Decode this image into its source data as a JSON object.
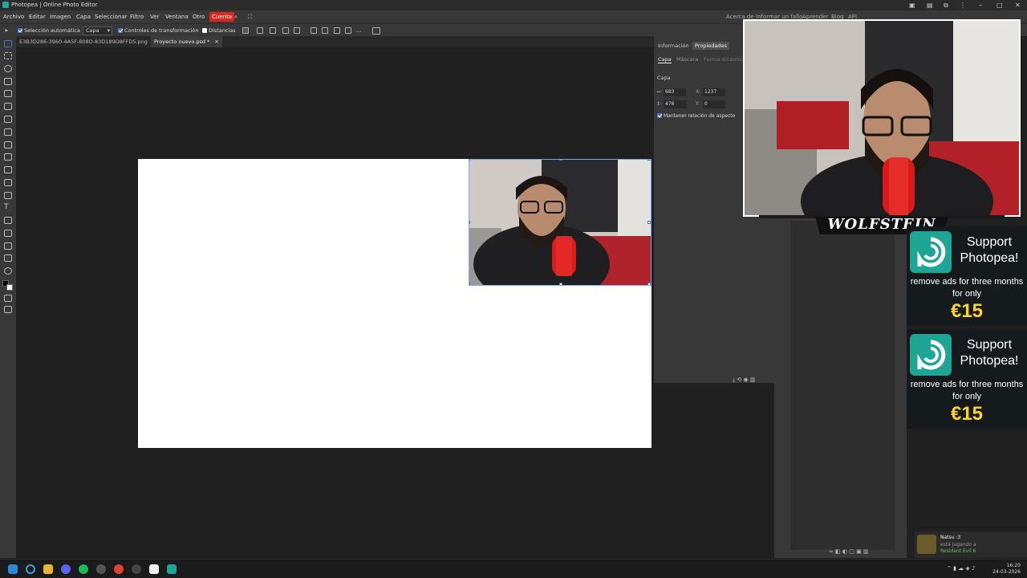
{
  "window": {
    "title": "Photopea | Online Photo Editor"
  },
  "menu": {
    "items": [
      "Archivo",
      "Editar",
      "Imagen",
      "Capa",
      "Seleccionar",
      "Filtro",
      "Ver",
      "Ventana",
      "Otro"
    ],
    "account": "Cuenta",
    "right_links": [
      "Acerca de",
      "Informar un fallo",
      "Aprender",
      "Blog",
      "API"
    ]
  },
  "options": {
    "auto_select": "Selección automática",
    "auto_select_checked": true,
    "target": "Capa",
    "transform_controls": "Controles de transformación",
    "transform_controls_checked": true,
    "distances": "Distancias",
    "distances_checked": false
  },
  "tabs": [
    {
      "label": "E3B3D286-3960-4A5F-808D-83D189D8FFD5.png",
      "active": false
    },
    {
      "label": "Proyecto nuevo.psd *",
      "active": true
    }
  ],
  "properties": {
    "panel_tabs": [
      "Información",
      "Propiedades"
    ],
    "sub_tabs": [
      "Capa",
      "Máscara",
      "Forma dinámica"
    ],
    "section": "Capa",
    "w": "683",
    "h": "476",
    "x": "1237",
    "y": "0",
    "w_label": "↔:",
    "h_label": "↕:",
    "x_label": "X:",
    "y_label": "Y:",
    "keep_ratio": "Mantener relación de aspecto",
    "keep_ratio_checked": true
  },
  "overlay": {
    "brand": "WOLFSTEIN"
  },
  "ads": [
    {
      "line1": "Support Photopea!",
      "line2": "remove ads for three months for only",
      "price": "€15"
    },
    {
      "line1": "Support Photopea!",
      "line2": "remove ads for three months for only",
      "price": "€15"
    }
  ],
  "notification": {
    "user": "Natsu :3",
    "status": "está jugando a",
    "game": "Resident Evil 6"
  },
  "clock": {
    "time": "16:20",
    "date": "24-03-2026"
  },
  "colors": {
    "accent": "#4a74c9",
    "account": "#d8281e",
    "ad_brand": "#1fa596",
    "price": "#ffd230"
  }
}
